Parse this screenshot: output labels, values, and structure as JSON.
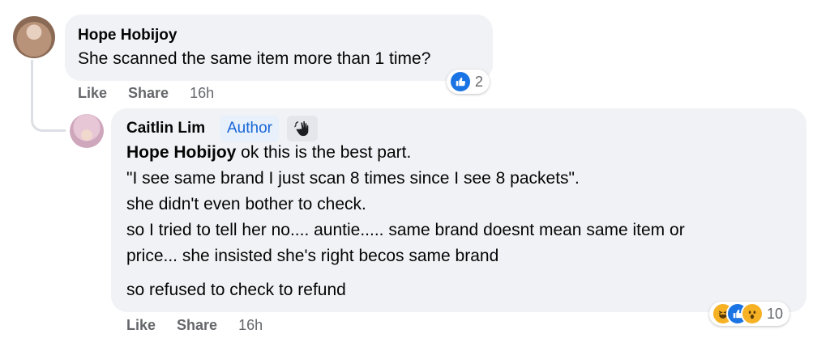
{
  "comment": {
    "author": "Hope Hobijoy",
    "text": "She scanned the same item more than 1 time?",
    "actions": {
      "like": "Like",
      "share": "Share",
      "time": "16h"
    },
    "reactions": {
      "count": "2",
      "types": [
        "like-icon"
      ]
    }
  },
  "reply": {
    "author": "Caitlin Lim",
    "badge": "Author",
    "mention": "Hope Hobijoy",
    "lines": [
      " ok this is the best part.",
      "\"I see same brand I just scan 8 times since I see 8 packets\".",
      "she didn't even bother to check.",
      "so I tried to tell her no.... auntie..... same brand doesnt mean same item or",
      "price... she insisted she's right becos same brand",
      "so refused to check to refund"
    ],
    "actions": {
      "like": "Like",
      "share": "Share",
      "time": "16h"
    },
    "reactions": {
      "count": "10",
      "types": [
        "haha-icon",
        "like-icon",
        "wow-icon"
      ]
    }
  },
  "colors": {
    "bubble": "#f0f2f5",
    "accent": "#1b74e4",
    "badge_bg": "#e7f0fb",
    "badge_text": "#1866d6",
    "meta_text": "#65676b"
  }
}
